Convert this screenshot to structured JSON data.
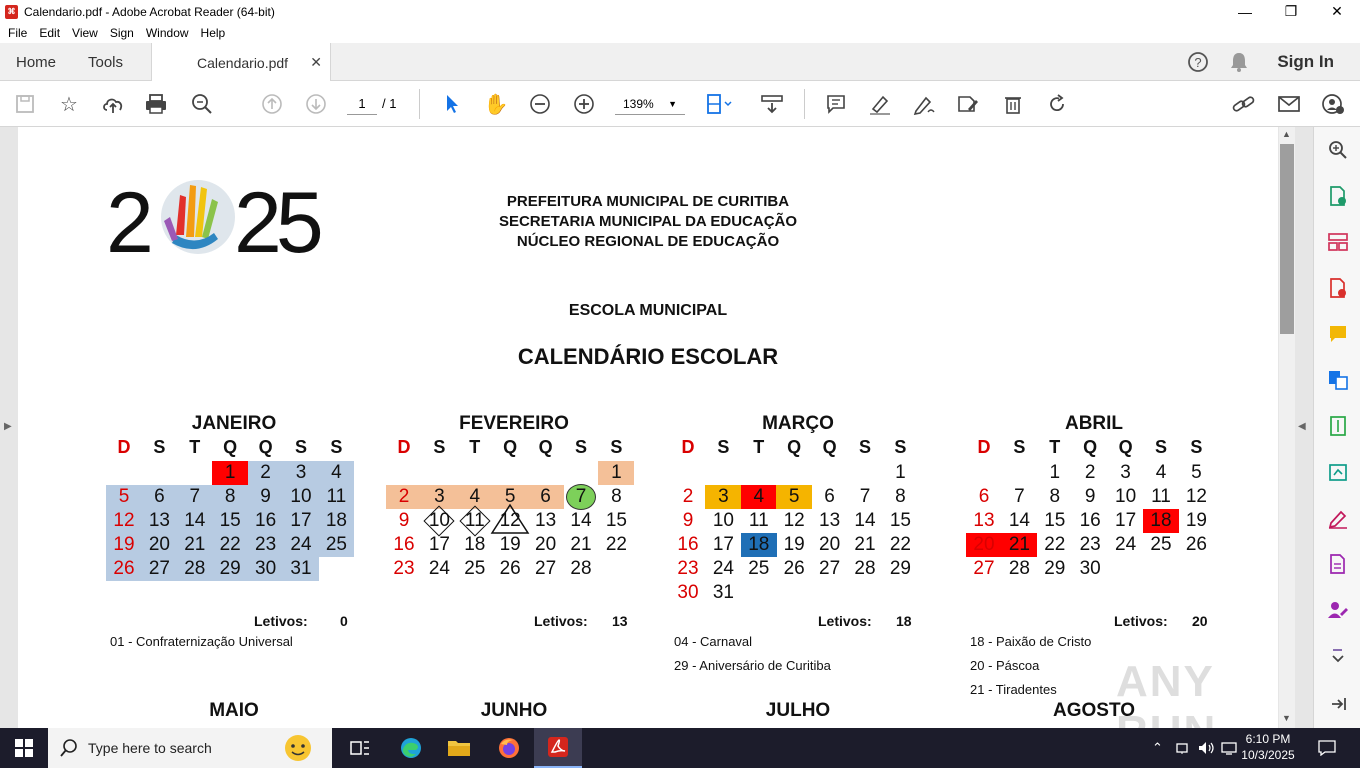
{
  "window": {
    "title": "Calendario.pdf - Adobe Acrobat Reader (64-bit)",
    "icon": "acrobat-icon"
  },
  "menu": [
    "File",
    "Edit",
    "View",
    "Sign",
    "Window",
    "Help"
  ],
  "tabs": {
    "home": "Home",
    "tools": "Tools",
    "doc": "Calendario.pdf",
    "signin": "Sign In"
  },
  "toolbar": {
    "page_current": "1",
    "page_total": "/ 1",
    "zoom": "139%"
  },
  "doc": {
    "header1": "PREFEITURA MUNICIPAL DE CURITIBA",
    "header2": "SECRETARIA MUNICIPAL DA EDUCAÇÃO",
    "header3": "NÚCLEO REGIONAL DE EDUCAÇÃO",
    "school": "ESCOLA MUNICIPAL",
    "title": "CALENDÁRIO ESCOLAR",
    "logo_text": "2025",
    "letivos_label": "Letivos:"
  },
  "weekdays": [
    "D",
    "S",
    "T",
    "Q",
    "Q",
    "S",
    "S"
  ],
  "months": [
    {
      "name": "JANEIRO",
      "start": 3,
      "days": 31,
      "letivos": "0",
      "marks": {
        "1": "red",
        "2": "blue",
        "3": "blue",
        "4": "blue",
        "5": "blue",
        "6": "blue",
        "7": "blue",
        "8": "blue",
        "9": "blue",
        "10": "blue",
        "11": "blue",
        "12": "blue",
        "13": "blue",
        "14": "blue",
        "15": "blue",
        "16": "blue",
        "17": "blue",
        "18": "blue",
        "19": "blue",
        "20": "blue",
        "21": "blue",
        "22": "blue",
        "23": "blue",
        "24": "blue",
        "25": "blue",
        "26": "blue",
        "27": "blue",
        "28": "blue",
        "29": "blue",
        "30": "blue",
        "31": "blue"
      },
      "holidays": [
        "01 - Confraternização Universal"
      ]
    },
    {
      "name": "FEVEREIRO",
      "start": 6,
      "days": 28,
      "letivos": "13",
      "marks": {
        "1": "orange",
        "2": "orange",
        "3": "orange",
        "4": "orange",
        "5": "orange",
        "6": "orange",
        "7": "circle",
        "10": "diamond",
        "11": "diamond",
        "12": "triangle"
      },
      "holidays": []
    },
    {
      "name": "MARÇO",
      "start": 6,
      "days": 31,
      "letivos": "18",
      "marks": {
        "3": "yellow",
        "4": "red",
        "5": "yellow",
        "18": "dblue"
      },
      "holidays": [
        "04 - Carnaval",
        "29 - Aniversário de Curitiba"
      ]
    },
    {
      "name": "ABRIL",
      "start": 2,
      "days": 30,
      "letivos": "20",
      "marks": {
        "18": "red",
        "20": "red",
        "21": "red"
      },
      "holidays": [
        "18 - Paixão de Cristo",
        "20 - Páscoa",
        "21 - Tiradentes"
      ]
    }
  ],
  "next_months": [
    "MAIO",
    "JUNHO",
    "JULHO",
    "AGOSTO"
  ],
  "watermark": "ANY RUN",
  "taskbar": {
    "search_placeholder": "Type here to search",
    "time": "6:10 PM",
    "date": "10/3/2025"
  }
}
